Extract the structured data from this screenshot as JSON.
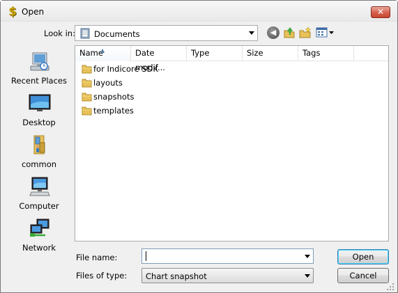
{
  "window": {
    "title": "Open",
    "close_glyph": "✕"
  },
  "lookin": {
    "label": "Look in:",
    "value": "Documents"
  },
  "places": [
    {
      "label": "Recent Places",
      "icon": "recent-places-icon"
    },
    {
      "label": "Desktop",
      "icon": "desktop-icon"
    },
    {
      "label": "common",
      "icon": "user-folder-icon"
    },
    {
      "label": "Computer",
      "icon": "computer-icon"
    },
    {
      "label": "Network",
      "icon": "network-icon"
    }
  ],
  "columns": [
    "Name",
    "Date modif...",
    "Type",
    "Size",
    "Tags"
  ],
  "files": [
    {
      "name": "for Indicore SDK"
    },
    {
      "name": "layouts"
    },
    {
      "name": "snapshots"
    },
    {
      "name": "templates"
    }
  ],
  "filename": {
    "label": "File name:",
    "value": ""
  },
  "filetype": {
    "label": "Files of type:",
    "value": "Chart snapshot"
  },
  "buttons": {
    "open": "Open",
    "cancel": "Cancel"
  },
  "colors": {
    "folder": "#e8c15a",
    "accent": "#3c7fb1"
  }
}
